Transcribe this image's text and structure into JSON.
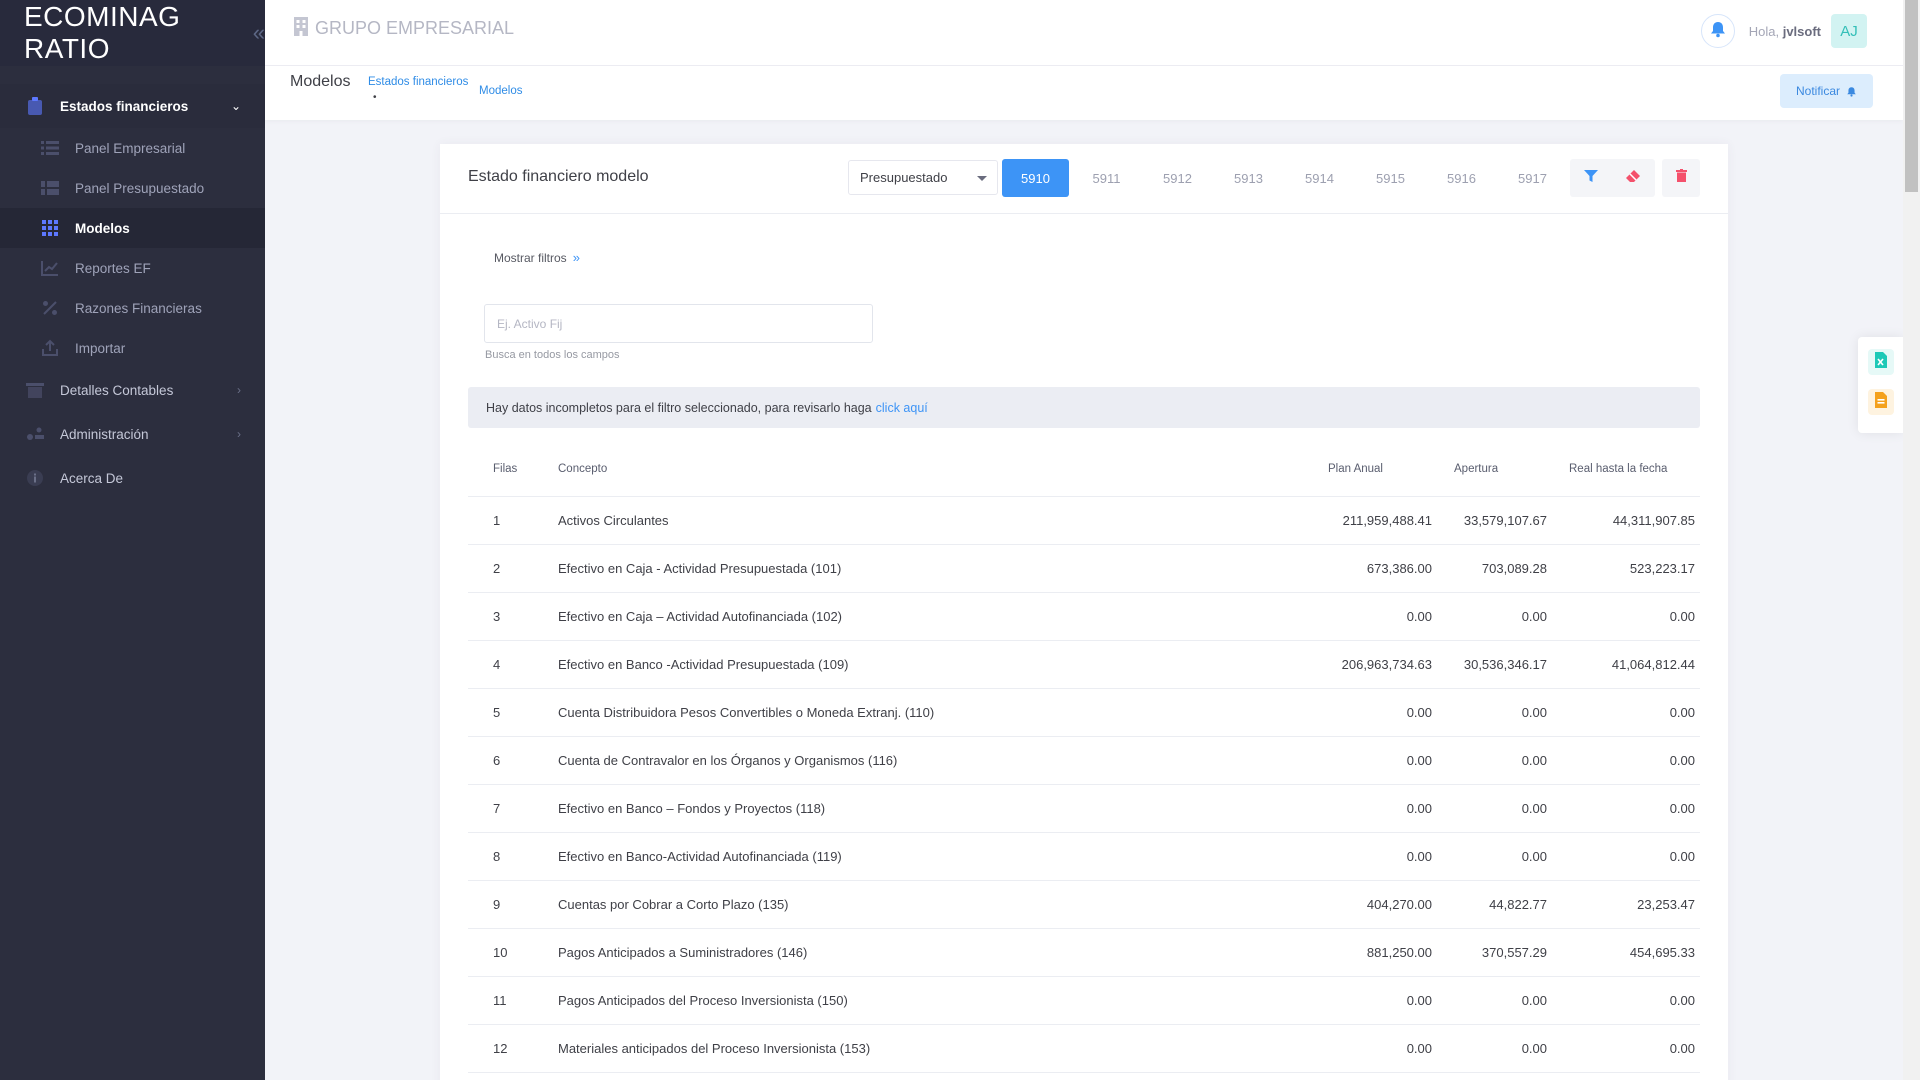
{
  "brand": {
    "name": "ECOMINAG RATIO",
    "toggle": "«"
  },
  "sidebar": {
    "group_open": {
      "label": "Estados financieros"
    },
    "subitems": [
      {
        "label": "Panel Empresarial"
      },
      {
        "label": "Panel Presupuestado"
      },
      {
        "label": "Modelos"
      },
      {
        "label": "Reportes EF"
      },
      {
        "label": "Razones Financieras"
      },
      {
        "label": "Importar"
      }
    ],
    "groups": [
      {
        "label": "Detalles Contables"
      },
      {
        "label": "Administración"
      },
      {
        "label": "Acerca De"
      }
    ]
  },
  "header": {
    "company": "GRUPO EMPRESARIAL",
    "greeting_prefix": "Hola,",
    "username": "jvlsoft",
    "avatar_initials": "AJ"
  },
  "subheader": {
    "title": "Modelos",
    "breadcrumb_1": "Estados financieros",
    "breadcrumb_dot": "•",
    "breadcrumb_2": "Modelos",
    "notify_label": "Notificar"
  },
  "card": {
    "title": "Estado financiero modelo",
    "select_value": "Presupuestado",
    "years": [
      "5910",
      "5911",
      "5912",
      "5913",
      "5914",
      "5915",
      "5916",
      "5917"
    ],
    "active_year": "5910",
    "filters_toggle": "Mostrar filtros",
    "search_placeholder": "Ej. Activo Fij",
    "search_hint": "Busca en todos los campos",
    "alert_text": "Hay datos incompletos para el filtro seleccionado, para revisarlo haga",
    "alert_link": "click aquí"
  },
  "table": {
    "headers": [
      "Filas",
      "Concepto",
      "Plan Anual",
      "Apertura",
      "Real hasta la fecha"
    ],
    "rows": [
      [
        "1",
        "Activos Circulantes",
        "211,959,488.41",
        "33,579,107.67",
        "44,311,907.85"
      ],
      [
        "2",
        "Efectivo en Caja - Actividad Presupuestada (101)",
        "673,386.00",
        "703,089.28",
        "523,223.17"
      ],
      [
        "3",
        "Efectivo en Caja – Actividad Autofinanciada (102)",
        "0.00",
        "0.00",
        "0.00"
      ],
      [
        "4",
        "Efectivo en Banco -Actividad Presupuestada (109)",
        "206,963,734.63",
        "30,536,346.17",
        "41,064,812.44"
      ],
      [
        "5",
        "Cuenta Distribuidora Pesos Convertibles o Moneda Extranj. (110)",
        "0.00",
        "0.00",
        "0.00"
      ],
      [
        "6",
        "Cuenta de Contravalor en los Órganos y Organismos (116)",
        "0.00",
        "0.00",
        "0.00"
      ],
      [
        "7",
        "Efectivo en Banco – Fondos y Proyectos (118)",
        "0.00",
        "0.00",
        "0.00"
      ],
      [
        "8",
        "Efectivo en Banco-Actividad Autofinanciada (119)",
        "0.00",
        "0.00",
        "0.00"
      ],
      [
        "9",
        "Cuentas por Cobrar a Corto Plazo (135)",
        "404,270.00",
        "44,822.77",
        "23,253.47"
      ],
      [
        "10",
        "Pagos Anticipados a Suministradores (146)",
        "881,250.00",
        "370,557.29",
        "454,695.33"
      ],
      [
        "11",
        "Pagos Anticipados del Proceso Inversionista (150)",
        "0.00",
        "0.00",
        "0.00"
      ],
      [
        "12",
        "Materiales anticipados del Proceso Inversionista (153)",
        "0.00",
        "0.00",
        "0.00"
      ]
    ]
  },
  "colors": {
    "sidebar_bg": "#2c2e3e",
    "accent": "#3d94f6",
    "excel_green": "#1dc9b7",
    "pdf_orange": "#f4a11d",
    "danger": "#f4516c"
  }
}
